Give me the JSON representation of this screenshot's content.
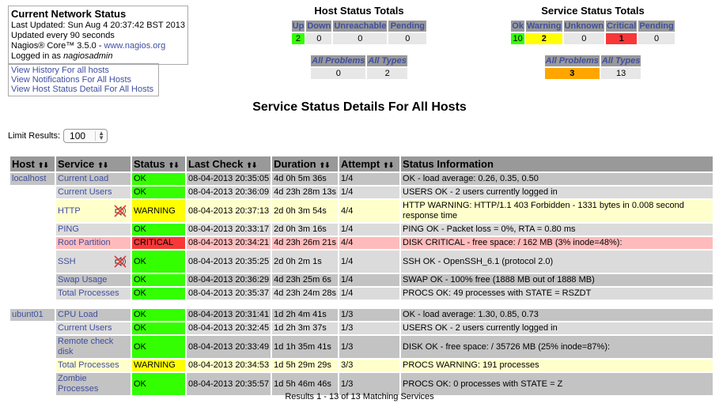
{
  "info": {
    "title": "Current Network Status",
    "last_updated": "Last Updated: Sun Aug 4 20:37:42 BST 2013",
    "update_interval": "Updated every 90 seconds",
    "version_prefix": "Nagios® Core™ 3.5.0 - ",
    "website": "www.nagios.org",
    "logged_in_prefix": "Logged in as ",
    "user": "nagiosadmin"
  },
  "links": [
    "View History For all hosts",
    "View Notifications For All Hosts",
    "View Host Status Detail For All Hosts"
  ],
  "host_totals": {
    "heading": "Host Status Totals",
    "headers": [
      "Up",
      "Down",
      "Unreachable",
      "Pending"
    ],
    "values": [
      "2",
      "0",
      "0",
      "0"
    ],
    "sub_headers": [
      "All Problems",
      "All Types"
    ],
    "sub_values": [
      "0",
      "2"
    ]
  },
  "service_totals": {
    "heading": "Service Status Totals",
    "headers": [
      "Ok",
      "Warning",
      "Unknown",
      "Critical",
      "Pending"
    ],
    "values": [
      "10",
      "2",
      "0",
      "1",
      "0"
    ],
    "sub_headers": [
      "All Problems",
      "All Types"
    ],
    "sub_values": [
      "3",
      "13"
    ]
  },
  "colors": {
    "ok": "#33ff00",
    "warning": "#ffff00",
    "critical": "#f83838",
    "problems": "#ffa500",
    "header": "#999999",
    "link": "#3f4f9f"
  },
  "page_title": "Service Status Details For All Hosts",
  "limit": {
    "label": "Limit Results:",
    "value": "100"
  },
  "table": {
    "headers": [
      "Host",
      "Service",
      "Status",
      "Last Check",
      "Duration",
      "Attempt",
      "Status Information"
    ],
    "rows": [
      {
        "host": "localhost",
        "service": "Current Load",
        "status": "OK",
        "last_check": "08-04-2013 20:35:05",
        "duration": "4d 0h 5m 36s",
        "attempt": "1/4",
        "info": "OK - load average: 0.26, 0.35, 0.50"
      },
      {
        "host": "",
        "service": "Current Users",
        "status": "OK",
        "last_check": "08-04-2013 20:36:09",
        "duration": "4d 23h 28m 13s",
        "attempt": "1/4",
        "info": "USERS OK - 2 users currently logged in"
      },
      {
        "host": "",
        "service": "HTTP",
        "status": "WARNING",
        "last_check": "08-04-2013 20:37:13",
        "duration": "2d 0h 3m 54s",
        "attempt": "4/4",
        "info": "HTTP WARNING: HTTP/1.1 403 Forbidden - 1331 bytes in 0.008 second response time",
        "notifications_disabled": true
      },
      {
        "host": "",
        "service": "PING",
        "status": "OK",
        "last_check": "08-04-2013 20:33:17",
        "duration": "2d 0h 3m 16s",
        "attempt": "1/4",
        "info": "PING OK - Packet loss = 0%, RTA = 0.80 ms"
      },
      {
        "host": "",
        "service": "Root Partition",
        "status": "CRITICAL",
        "last_check": "08-04-2013 20:34:21",
        "duration": "4d 23h 26m 21s",
        "attempt": "4/4",
        "info": "DISK CRITICAL - free space: / 162 MB (3% inode=48%):"
      },
      {
        "host": "",
        "service": "SSH",
        "status": "OK",
        "last_check": "08-04-2013 20:35:25",
        "duration": "2d 0h 2m 1s",
        "attempt": "1/4",
        "info": "SSH OK - OpenSSH_6.1 (protocol 2.0)",
        "notifications_disabled": true
      },
      {
        "host": "",
        "service": "Swap Usage",
        "status": "OK",
        "last_check": "08-04-2013 20:36:29",
        "duration": "4d 23h 25m 6s",
        "attempt": "1/4",
        "info": "SWAP OK - 100% free (1888 MB out of 1888 MB)"
      },
      {
        "host": "",
        "service": "Total Processes",
        "status": "OK",
        "last_check": "08-04-2013 20:35:37",
        "duration": "4d 23h 24m 28s",
        "attempt": "1/4",
        "info": "PROCS OK: 49 processes with STATE = RSZDT"
      },
      {
        "host": "ubunt01",
        "service": "CPU Load",
        "status": "OK",
        "last_check": "08-04-2013 20:31:41",
        "duration": "1d 2h 4m 41s",
        "attempt": "1/3",
        "info": "OK - load average: 1.30, 0.85, 0.73"
      },
      {
        "host": "",
        "service": "Current Users",
        "status": "OK",
        "last_check": "08-04-2013 20:32:45",
        "duration": "1d 2h 3m 37s",
        "attempt": "1/3",
        "info": "USERS OK - 2 users currently logged in"
      },
      {
        "host": "",
        "service": "Remote check disk",
        "status": "OK",
        "last_check": "08-04-2013 20:33:49",
        "duration": "1d 1h 35m 41s",
        "attempt": "1/3",
        "info": "DISK OK - free space: / 35726 MB (25% inode=87%):"
      },
      {
        "host": "",
        "service": "Total Processes",
        "status": "WARNING",
        "last_check": "08-04-2013 20:34:53",
        "duration": "1d 5h 29m 29s",
        "attempt": "3/3",
        "info": "PROCS WARNING: 191 processes"
      },
      {
        "host": "",
        "service": "Zombie Processes",
        "status": "OK",
        "last_check": "08-04-2013 20:35:57",
        "duration": "1d 5h 46m 46s",
        "attempt": "1/3",
        "info": "PROCS OK: 0 processes with STATE = Z"
      }
    ]
  },
  "results_text": "Results 1 - 13 of 13 Matching Services"
}
